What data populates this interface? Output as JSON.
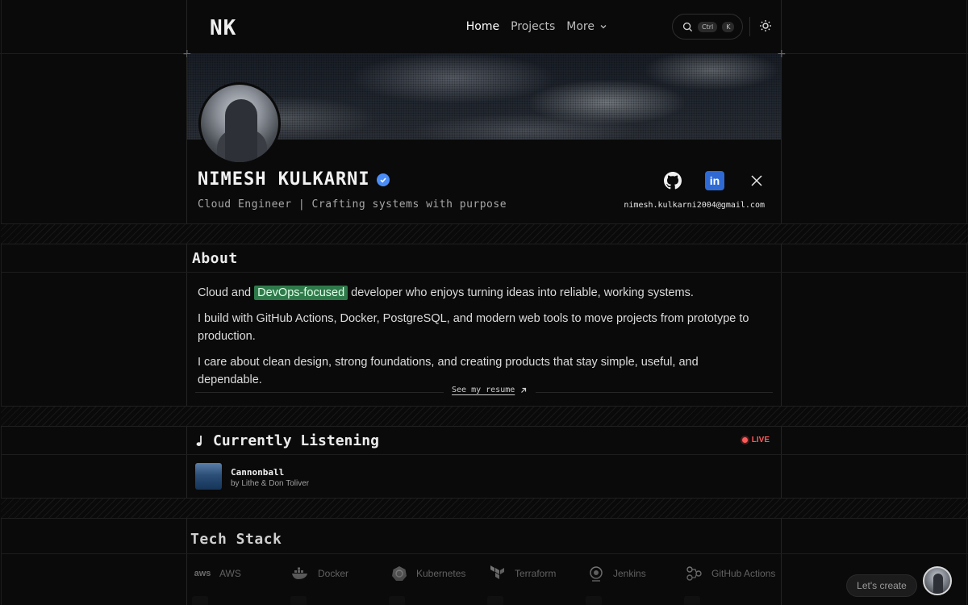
{
  "header": {
    "logo": "NK",
    "nav": {
      "home": "Home",
      "projects": "Projects",
      "more": "More"
    },
    "search": {
      "kbd_ctrl": "Ctrl",
      "kbd_k": "K"
    }
  },
  "profile": {
    "name": "NIMESH KULKARNI",
    "tagline": "Cloud Engineer | Crafting systems with purpose",
    "email": "nimesh.kulkarni2004@gmail.com",
    "linkedin_glyph": "in"
  },
  "about": {
    "title": "About",
    "p1_prefix": "Cloud and ",
    "p1_highlight": "DevOps-focused",
    "p1_suffix": " developer who enjoys turning ideas into reliable, working systems.",
    "p2": "I build with GitHub Actions, Docker, PostgreSQL, and modern web tools to move projects from prototype to production.",
    "p3": "I care about clean design, strong foundations, and creating products that stay simple, useful, and dependable.",
    "resume_link": "See my resume"
  },
  "listening": {
    "title": "Currently Listening",
    "live_label": "LIVE",
    "track": "Cannonball",
    "artist": "by Lithe & Don Toliver"
  },
  "tech": {
    "title": "Tech Stack",
    "items": [
      {
        "label": "AWS",
        "icon": "aws-icon"
      },
      {
        "label": "Docker",
        "icon": "docker-icon"
      },
      {
        "label": "Kubernetes",
        "icon": "kubernetes-icon"
      },
      {
        "label": "Terraform",
        "icon": "terraform-icon"
      },
      {
        "label": "Jenkins",
        "icon": "jenkins-icon"
      },
      {
        "label": "GitHub Actions",
        "icon": "github-actions-icon"
      }
    ]
  },
  "floating": {
    "lets_create": "Let's create"
  },
  "colors": {
    "accent_highlight": "#2f7a4a",
    "live": "#ff5a5a",
    "verified": "#4b8df8",
    "linkedin": "#2f6ad4"
  }
}
